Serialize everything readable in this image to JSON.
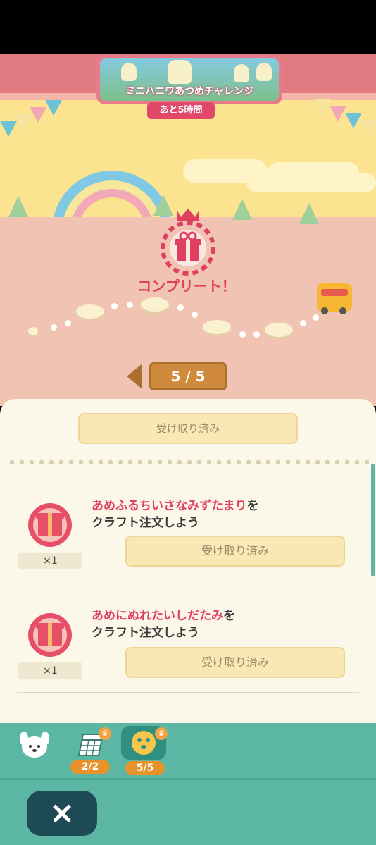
{
  "event": {
    "title": "ミニハニワあつめチャレンジ",
    "timer": "あと5時間"
  },
  "status": {
    "complete_label": "コンプリート！"
  },
  "pager": {
    "label": "5 / 5"
  },
  "panel": {
    "top_claim_label": "受け取り済み",
    "missions": [
      {
        "item_name": "あめふるちいさなみずたまり",
        "suffix": "を",
        "line2": "クラフト注文しよう",
        "qty": "×1",
        "button": "受け取り済み"
      },
      {
        "item_name": "あめにぬれたいしだたみ",
        "suffix": "を",
        "line2": "クラフト注文しよう",
        "qty": "×1",
        "button": "受け取り済み"
      }
    ]
  },
  "nav": {
    "tabs": [
      {
        "icon": "isabelle-icon",
        "badge": ""
      },
      {
        "icon": "calendar-icon",
        "badge": "2/2"
      },
      {
        "icon": "haniwa-icon",
        "badge": "5/5"
      }
    ]
  },
  "footer": {
    "close_icon": "×"
  },
  "colors": {
    "accent": "#e0405f",
    "nav": "#5bb7a4",
    "panel": "#fbf8ea",
    "close_button": "#1e4a55"
  }
}
